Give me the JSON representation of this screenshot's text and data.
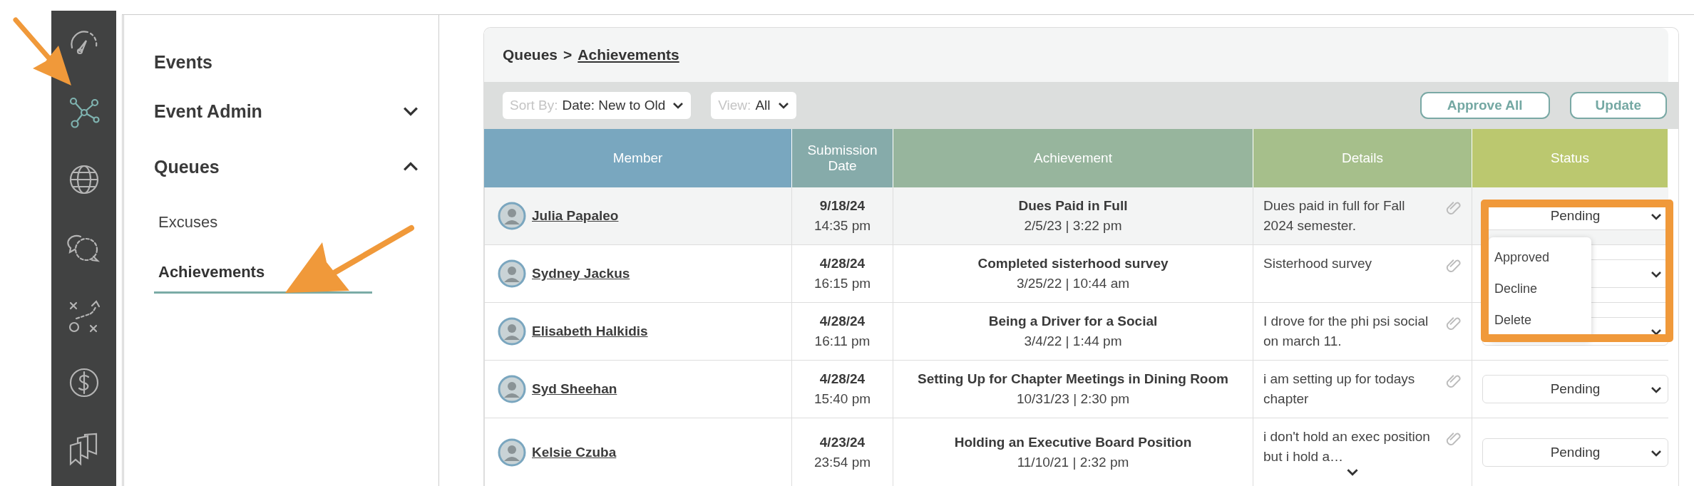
{
  "icon_rail": {
    "items": [
      {
        "selected": false
      },
      {
        "selected": true
      },
      {
        "selected": false
      },
      {
        "selected": false
      },
      {
        "selected": false
      },
      {
        "selected": false
      },
      {
        "selected": false
      }
    ]
  },
  "nav": {
    "items": [
      {
        "label": "Events",
        "kind": "link"
      },
      {
        "label": "Event Admin",
        "kind": "group",
        "expanded": false
      },
      {
        "label": "Queues",
        "kind": "group",
        "expanded": true,
        "children": [
          {
            "label": "Excuses",
            "selected": false
          },
          {
            "label": "Achievements",
            "selected": true
          }
        ]
      }
    ]
  },
  "breadcrumb": {
    "parent": "Queues",
    "separator": ">",
    "current": "Achievements"
  },
  "toolbar": {
    "sort": {
      "label": "Sort By:",
      "value": "Date: New to Old"
    },
    "view": {
      "label": "View:",
      "value": "All"
    },
    "buttons": [
      "Approve All",
      "Update"
    ]
  },
  "table": {
    "columns": [
      {
        "label": "Member",
        "color": "#79a7bf"
      },
      {
        "label": "Submission Date",
        "color": "#86abaa"
      },
      {
        "label": "Achievement",
        "color": "#97b59d"
      },
      {
        "label": "Details",
        "color": "#a6bf8b"
      },
      {
        "label": "Status",
        "color": "#bbc86f"
      }
    ],
    "rows": [
      {
        "member": "Julia Papaleo",
        "submitted_date": "9/18/24",
        "submitted_time": "14:35 pm",
        "achievement": "Dues Paid in Full",
        "achievement_date": "2/5/23 | 3:22 pm",
        "details": "Dues paid in full for Fall 2024 semester.",
        "status": "Pending",
        "highlighted": true,
        "expandable": false,
        "status_options": [
          "Approved",
          "Decline",
          "Delete"
        ]
      },
      {
        "member": "Sydney Jackus",
        "submitted_date": "4/28/24",
        "submitted_time": "16:15 pm",
        "achievement": "Completed sisterhood survey",
        "achievement_date": "3/25/22 | 10:44 am",
        "details": "Sisterhood survey",
        "highlighted": false,
        "expandable": false
      },
      {
        "member": "Elisabeth Halkidis",
        "submitted_date": "4/28/24",
        "submitted_time": "16:11 pm",
        "achievement": "Being a Driver for a Social",
        "achievement_date": "3/4/22 | 1:44 pm",
        "details": "I drove for the phi psi social on march 11.",
        "highlighted": false,
        "expandable": false
      },
      {
        "member": "Syd Sheehan",
        "submitted_date": "4/28/24",
        "submitted_time": "15:40 pm",
        "achievement": "Setting Up for Chapter Meetings in Dining Room",
        "achievement_date": "10/31/23 | 2:30 pm",
        "details": "i am setting up for todays chapter",
        "status": "Pending",
        "highlighted": false,
        "expandable": false
      },
      {
        "member": "Kelsie Czuba",
        "submitted_date": "4/23/24",
        "submitted_time": "23:54 pm",
        "achievement": "Holding an Executive Board Position",
        "achievement_date": "11/10/21 | 2:32 pm",
        "details": "i don't hold an exec position but i hold a…",
        "status": "Pending",
        "highlighted": false,
        "expandable": true
      }
    ]
  }
}
